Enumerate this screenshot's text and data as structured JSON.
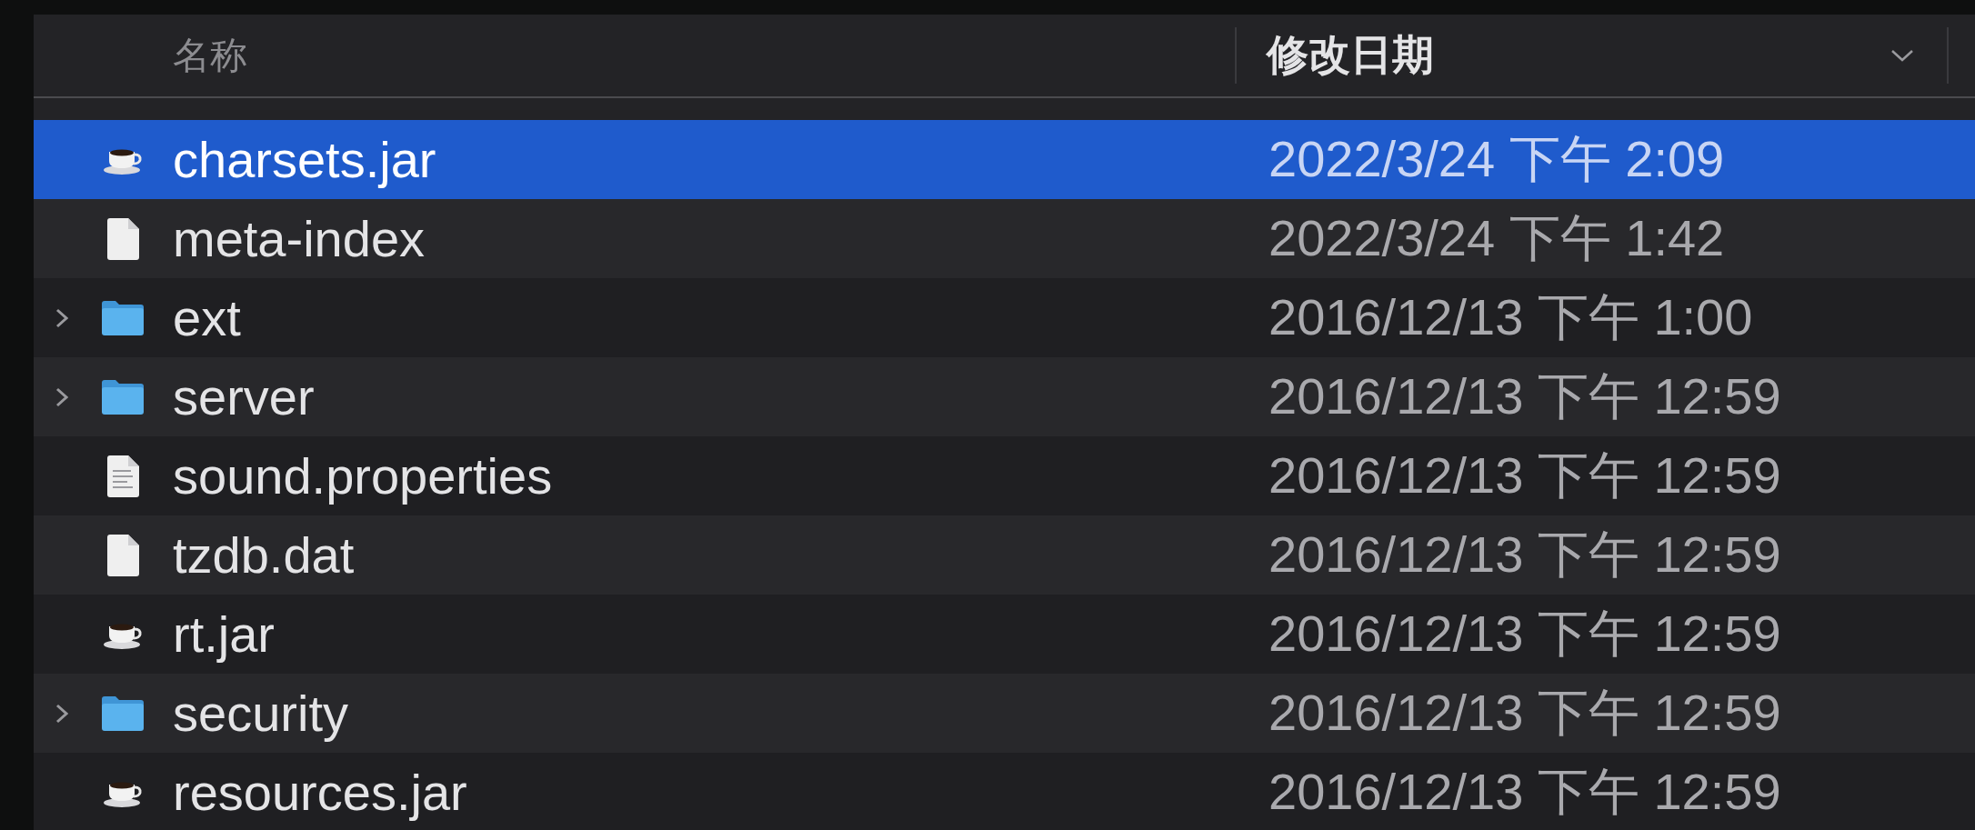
{
  "columns": [
    {
      "label": "名称",
      "sorted": false
    },
    {
      "label": "修改日期",
      "sorted": true
    }
  ],
  "rows": [
    {
      "name": "charsets.jar",
      "date": "2022/3/24 下午 2:09",
      "kind": "jar",
      "selected": true
    },
    {
      "name": "meta-index",
      "date": "2022/3/24 下午 1:42",
      "kind": "file",
      "selected": false
    },
    {
      "name": "ext",
      "date": "2016/12/13 下午 1:00",
      "kind": "folder",
      "expanded": false,
      "selected": false
    },
    {
      "name": "server",
      "date": "2016/12/13 下午 12:59",
      "kind": "folder",
      "expanded": false,
      "selected": false
    },
    {
      "name": "sound.properties",
      "date": "2016/12/13 下午 12:59",
      "kind": "text",
      "selected": false
    },
    {
      "name": "tzdb.dat",
      "date": "2016/12/13 下午 12:59",
      "kind": "file",
      "selected": false
    },
    {
      "name": "rt.jar",
      "date": "2016/12/13 下午 12:59",
      "kind": "jar",
      "selected": false
    },
    {
      "name": "security",
      "date": "2016/12/13 下午 12:59",
      "kind": "folder",
      "expanded": false,
      "selected": false
    },
    {
      "name": "resources.jar",
      "date": "2016/12/13 下午 12:59",
      "kind": "jar",
      "selected": false
    }
  ]
}
